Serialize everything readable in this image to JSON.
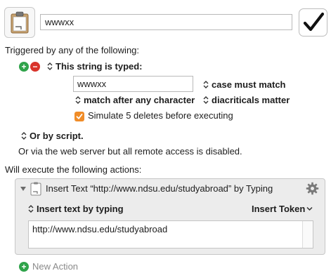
{
  "macro": {
    "name": "wwwxx",
    "enabled": true,
    "icon": "clipboard-icon"
  },
  "trigger": {
    "heading": "Triggered by any of the following:",
    "type_label": "This string is typed:",
    "string_value": "wwwxx",
    "case_option": "case must match",
    "match_option": "match after any character",
    "diacriticals_option": "diacriticals matter",
    "simulate_label": "Simulate 5 deletes before executing",
    "simulate_checked": true,
    "script_option": "Or by script.",
    "web_server_note": "Or via the web server but all remote access is disabled."
  },
  "actions": {
    "heading": "Will execute the following actions:",
    "items": [
      {
        "title": "Insert Text “http://www.ndsu.edu/studyabroad” by Typing",
        "method_label": "Insert text by typing",
        "insert_token_label": "Insert Token",
        "text": "http://www.ndsu.edu/studyabroad"
      }
    ],
    "new_action_label": "New Action"
  },
  "colors": {
    "accent_orange": "#f08c28",
    "add_green": "#2fa34a",
    "remove_red": "#d9342b"
  }
}
